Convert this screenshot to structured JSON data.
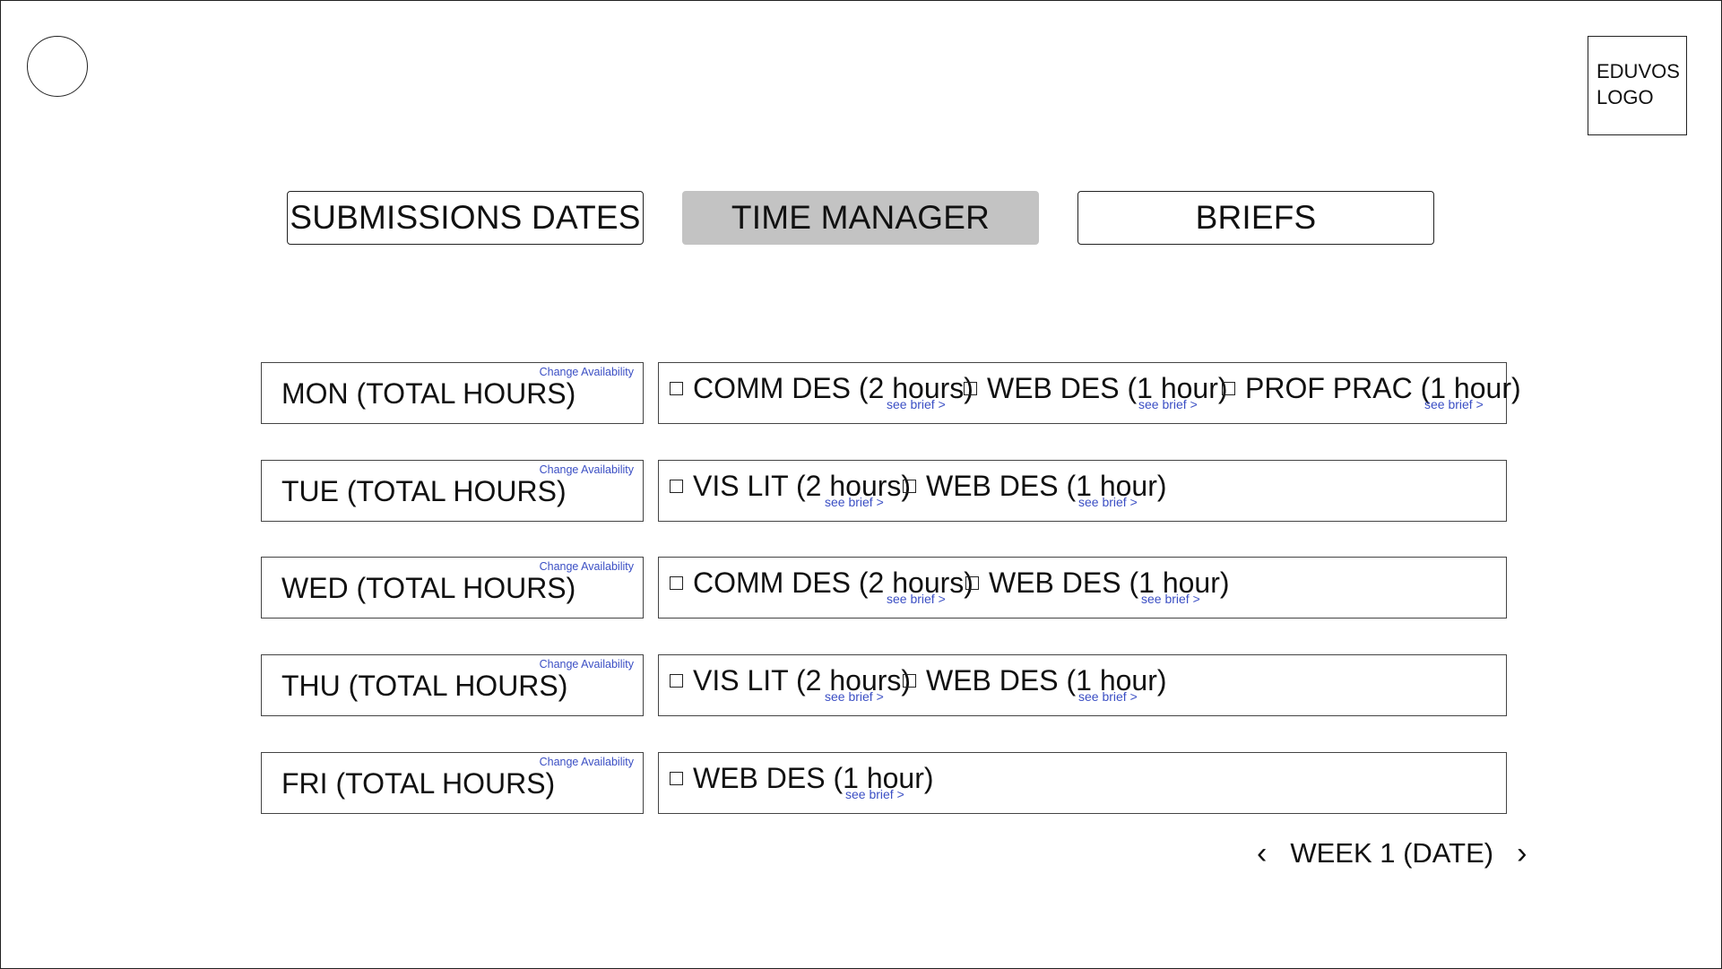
{
  "brand": {
    "logo_text_line1": "EDUVOS",
    "logo_text_line2": "LOGO"
  },
  "nav": {
    "tabs": [
      {
        "label": "SUBMISSIONS DATES",
        "active": false
      },
      {
        "label": "TIME MANAGER",
        "active": true
      },
      {
        "label": "BRIEFS",
        "active": false
      }
    ]
  },
  "links": {
    "change_availability": "Change Availability",
    "see_brief": "see brief >"
  },
  "days": [
    {
      "label": "MON (TOTAL HOURS)",
      "tasks": [
        {
          "label": "COMM DES (2 hours)"
        },
        {
          "label": "WEB DES (1 hour)"
        },
        {
          "label": "PROF PRAC (1 hour)"
        }
      ]
    },
    {
      "label": "TUE (TOTAL HOURS)",
      "tasks": [
        {
          "label": "VIS LIT (2 hours)"
        },
        {
          "label": "WEB DES (1 hour)"
        }
      ]
    },
    {
      "label": "WED (TOTAL HOURS)",
      "tasks": [
        {
          "label": "COMM DES (2 hours)"
        },
        {
          "label": "WEB DES (1 hour)"
        }
      ]
    },
    {
      "label": "THU (TOTAL HOURS)",
      "tasks": [
        {
          "label": "VIS LIT (2 hours)"
        },
        {
          "label": "WEB DES (1 hour)"
        }
      ]
    },
    {
      "label": "FRI (TOTAL HOURS)",
      "tasks": [
        {
          "label": "WEB DES (1 hour)"
        }
      ]
    }
  ],
  "week": {
    "label": "WEEK 1 (DATE)",
    "prev_icon": "chevron-left-icon",
    "next_icon": "chevron-right-icon"
  },
  "colors": {
    "link": "#3b4fc4",
    "active_tab": "#c3c3c3",
    "border": "#222222"
  }
}
